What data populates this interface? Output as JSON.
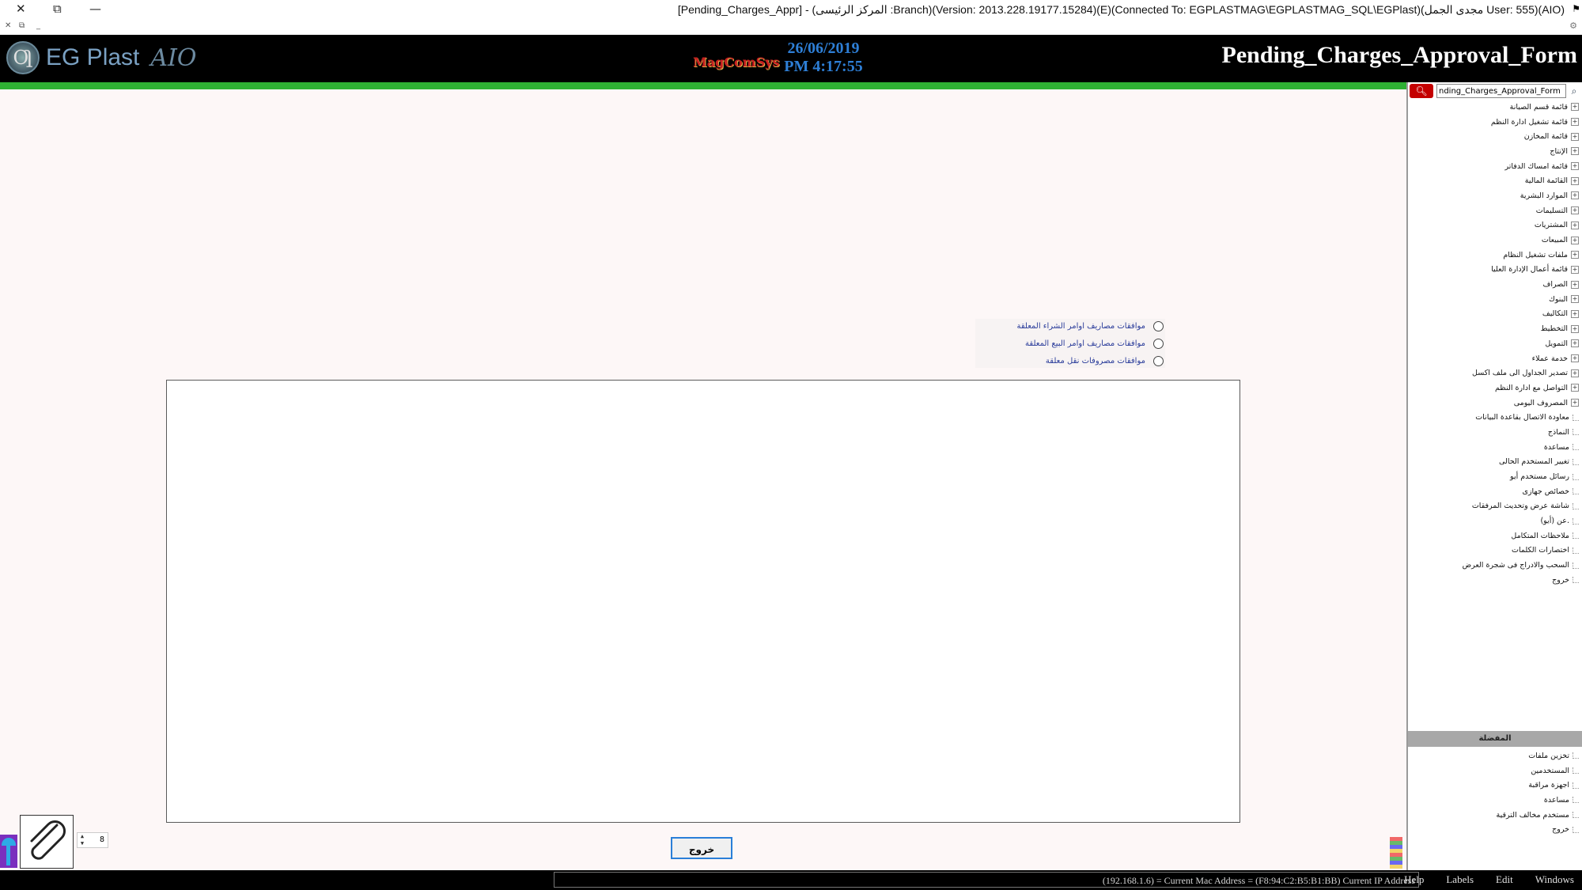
{
  "window": {
    "title": "[Pending_Charges_Appr] - (المركز الرئيسى :Branch)(Version: 2013.228.19177.15284)(E)(Connected To: EGPLASTMAG\\EGPLASTMAG_SQL\\EGPlast)(مجدى الجمل User: 555)(AIO)"
  },
  "header": {
    "logo_text": "EG Plast",
    "logo_glyph": "Ƣ",
    "logo_signature": "AIO",
    "brand": "MagComSys",
    "date": "26/06/2019",
    "time": "PM 4:17:55",
    "form_title": "Pending_Charges_Approval_Form"
  },
  "main": {
    "radios": [
      {
        "label": "موافقات مصاريف اوامر الشراء المعلقة"
      },
      {
        "label": "موافقات مصاريف اوامر البيع المعلقة"
      },
      {
        "label": "موافقات مصروفات نقل معلقة"
      }
    ],
    "exit_label": "خروج",
    "attachments_count": "8"
  },
  "sidebar": {
    "search_value": "nding_Charges_Approval_Form",
    "tree": [
      {
        "label": "قائمة قسم الصيانة",
        "expandable": true
      },
      {
        "label": "قائمة تشغيل ادارة النظم",
        "expandable": true
      },
      {
        "label": "قائمة المخازن",
        "expandable": true
      },
      {
        "label": "الإنتاج",
        "expandable": true
      },
      {
        "label": "قائمة امساك الدفاتر",
        "expandable": true
      },
      {
        "label": "القائمة المالية",
        "expandable": true
      },
      {
        "label": "الموارد البشرية",
        "expandable": true
      },
      {
        "label": "التسليمات",
        "expandable": true
      },
      {
        "label": "المشتريات",
        "expandable": true
      },
      {
        "label": "المبيعات",
        "expandable": true
      },
      {
        "label": "ملفات تشغيل النظام",
        "expandable": true
      },
      {
        "label": "قائمة أعمال الإدارة العليا",
        "expandable": true
      },
      {
        "label": "الصراف",
        "expandable": true
      },
      {
        "label": "البنوك",
        "expandable": true
      },
      {
        "label": "التكاليف",
        "expandable": true
      },
      {
        "label": "التخطيط",
        "expandable": true
      },
      {
        "label": "التمويل",
        "expandable": true
      },
      {
        "label": "خدمة عملاء",
        "expandable": true
      },
      {
        "label": "تصدير الجداول الى ملف اكسل",
        "expandable": true
      },
      {
        "label": "التواصل مع ادارة النظم",
        "expandable": true
      },
      {
        "label": "المصروف اليومى",
        "expandable": true
      },
      {
        "label": "معاودة الاتصال بقاعدة البيانات",
        "expandable": false
      },
      {
        "label": "النماذج",
        "expandable": false
      },
      {
        "label": "مساعدة",
        "expandable": false
      },
      {
        "label": "تغيير المستخدم الحالى",
        "expandable": false
      },
      {
        "label": "رسائل مستخدم أيو",
        "expandable": false
      },
      {
        "label": "خصائص جهازى",
        "expandable": false
      },
      {
        "label": "شاشة عرض وتحديث المرفقات",
        "expandable": false
      },
      {
        "label": "عن (أيو).",
        "expandable": false
      },
      {
        "label": "ملاحظات المتكامل",
        "expandable": false
      },
      {
        "label": "اختصارات الكلمات",
        "expandable": false
      },
      {
        "label": "السحب والادراج فى شجرة العرض",
        "expandable": false
      },
      {
        "label": "خروج",
        "expandable": false
      }
    ],
    "sub_header": "المفضلة",
    "sub_items": [
      {
        "label": "تخزين ملفات"
      },
      {
        "label": "المستخدمين"
      },
      {
        "label": "اجهزة مراقبة"
      },
      {
        "label": "مساعدة"
      },
      {
        "label": "مستخدم مخالف الترقية"
      },
      {
        "label": "خروج"
      }
    ]
  },
  "status": {
    "info": "(192.168.1.6) = Current Mac Address = (F8:94:C2:B5:B1:BB) Current IP Address",
    "menu": [
      "Help",
      "Labels",
      "Edit",
      "Windows"
    ]
  },
  "colors": {
    "header_bg": "#000000",
    "accent_green": "#2fb033",
    "date_blue": "#2e7fd6",
    "search_red": "#c40000",
    "radio_label": "#2a3c9a"
  }
}
